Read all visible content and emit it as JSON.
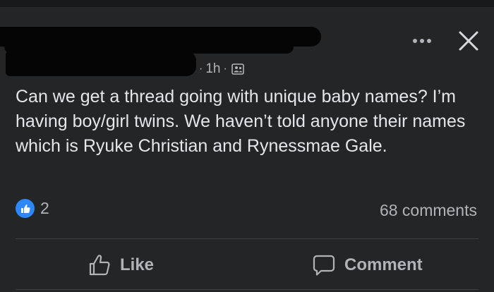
{
  "post": {
    "time": "1h",
    "separator": "·",
    "text": "Can we get a thread going with unique baby names? I’m having boy/girl twins. We haven’t told anyone their names which is Ryuke Christian and Rynessmae Gale.",
    "reaction_count": "2",
    "comment_count": "68 comments"
  },
  "actions": {
    "like_label": "Like",
    "comment_label": "Comment"
  },
  "icons": {
    "more": "more-options-icon",
    "close": "close-icon",
    "audience": "friends-audience-icon",
    "like_reaction": "thumbs-up-icon",
    "comment": "comment-bubble-icon"
  },
  "colors": {
    "background": "#242526",
    "text": "#e4e6eb",
    "muted": "#b0b3b8",
    "like_blue": "#2d88ff"
  }
}
